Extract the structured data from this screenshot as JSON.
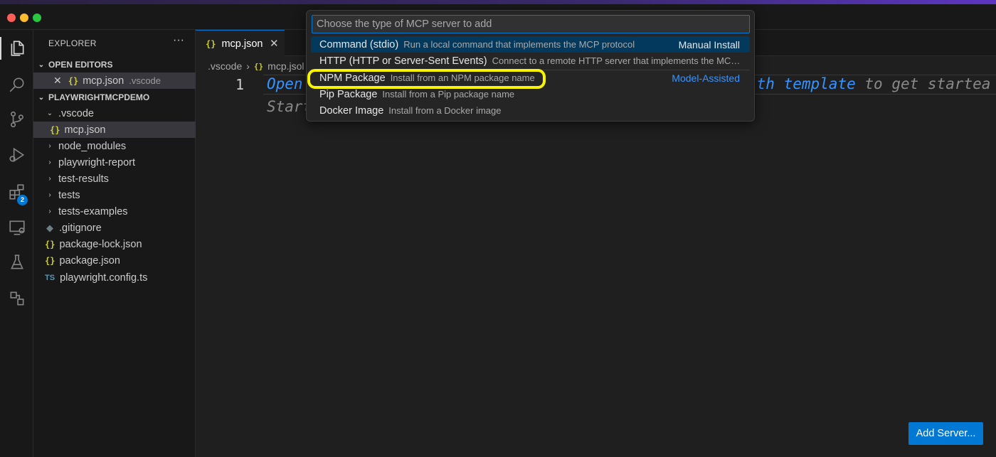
{
  "window": {
    "traffic_lights": [
      "close",
      "minimize",
      "zoom"
    ]
  },
  "activity_bar": {
    "items": [
      {
        "name": "explorer-icon",
        "active": true
      },
      {
        "name": "search-icon"
      },
      {
        "name": "source-control-icon"
      },
      {
        "name": "run-debug-icon"
      },
      {
        "name": "extensions-icon",
        "badge": "2"
      },
      {
        "name": "remote-explorer-icon"
      },
      {
        "name": "testing-icon"
      },
      {
        "name": "mcp-servers-icon"
      }
    ]
  },
  "sidebar": {
    "title": "EXPLORER",
    "more": "···",
    "open_editors": {
      "header": "OPEN EDITORS",
      "items": [
        {
          "close": "✕",
          "icon": "{}",
          "name": "mcp.json",
          "folder": ".vscode"
        }
      ]
    },
    "workspace": {
      "header": "PLAYWRIGHTMCPDEMO",
      "tree": [
        {
          "chevron": "⌄",
          "name": ".vscode"
        },
        {
          "icon": "{}",
          "name": "mcp.json"
        },
        {
          "chevron": "›",
          "name": "node_modules"
        },
        {
          "chevron": "›",
          "name": "playwright-report"
        },
        {
          "chevron": "›",
          "name": "test-results"
        },
        {
          "chevron": "›",
          "name": "tests"
        },
        {
          "chevron": "›",
          "name": "tests-examples"
        },
        {
          "icon": "◆",
          "name": ".gitignore"
        },
        {
          "icon": "{}",
          "name": "package-lock.json"
        },
        {
          "icon": "{}",
          "name": "package.json"
        },
        {
          "icon": "TS",
          "name": "playwright.config.ts"
        }
      ]
    }
  },
  "editor": {
    "tab": {
      "icon": "{}",
      "label": "mcp.json",
      "close": "✕"
    },
    "breadcrumb": [
      ".vscode",
      "mcp.jsol"
    ],
    "breadcrumb_sep": "›",
    "breadcrumb_icon": "{}",
    "line_number": "1",
    "ghost_line1_start": "Open",
    "ghost_line1_end_kw_prefix": "ith",
    "ghost_line1_end_kw": "template",
    "ghost_line1_end_rest": "to get startea",
    "ghost_line2_start": "Start",
    "add_server_button": "Add Server..."
  },
  "quick_pick": {
    "placeholder": "Choose the type of MCP server to add",
    "items": [
      {
        "label": "Command (stdio)",
        "description": "Run a local command that implements the MCP protocol",
        "right": "Manual Install"
      },
      {
        "label": "HTTP (HTTP or Server-Sent Events)",
        "description": "Connect to a remote HTTP server that implements the MC…"
      },
      {
        "label": "NPM Package",
        "description": "Install from an NPM package name",
        "right": "Model-Assisted"
      },
      {
        "label": "Pip Package",
        "description": "Install from a Pip package name"
      },
      {
        "label": "Docker Image",
        "description": "Install from a Docker image"
      }
    ]
  },
  "colors": {
    "accent": "#0078d4",
    "link": "#3794ff",
    "highlight": "#f8f400",
    "focused_item": "#04395e"
  }
}
